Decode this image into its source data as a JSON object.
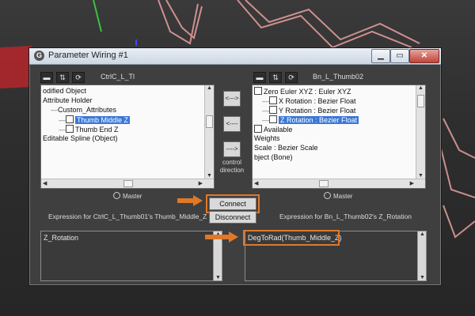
{
  "dialog": {
    "title": "Parameter Wiring #1",
    "window_buttons": {
      "minimize": "▁",
      "maximize": "▭",
      "close": "✕"
    }
  },
  "left_panel": {
    "node_name": "CtrlC_L_Tl",
    "tree_items": [
      {
        "label": "odified Object",
        "indent": 0,
        "checkbox": false,
        "selected": false
      },
      {
        "label": "Attribute Holder",
        "indent": 0,
        "checkbox": false,
        "selected": false
      },
      {
        "label": "Custom_Attributes",
        "indent": 1,
        "checkbox": false,
        "selected": false
      },
      {
        "label": "Thumb Middle Z",
        "indent": 2,
        "checkbox": true,
        "selected": true
      },
      {
        "label": "Thumb End Z",
        "indent": 2,
        "checkbox": true,
        "selected": false
      },
      {
        "label": "Editable Spline (Object)",
        "indent": 0,
        "checkbox": false,
        "selected": false
      }
    ],
    "master_label": "Master",
    "expression_label": "Expression for CtrlC_L_Thumb01's Thumb_Middle_Z",
    "expression_text": "Z_Rotation"
  },
  "right_panel": {
    "node_name": "Bn_L_Thumb02",
    "tree_items": [
      {
        "label": "Zero Euler XYZ : Euler XYZ",
        "indent": 0,
        "checkbox": true,
        "selected": false
      },
      {
        "label": "X Rotation : Bezier Float",
        "indent": 1,
        "checkbox": true,
        "selected": false
      },
      {
        "label": "Y Rotation : Bezier Float",
        "indent": 1,
        "checkbox": true,
        "selected": false
      },
      {
        "label": "Z Rotation : Bezier Float",
        "indent": 1,
        "checkbox": true,
        "selected": true
      },
      {
        "label": "Available",
        "indent": 0,
        "checkbox": true,
        "selected": false
      },
      {
        "label": "Weights",
        "indent": 0,
        "checkbox": false,
        "selected": false
      },
      {
        "label": "Scale : Bezier Scale",
        "indent": 0,
        "checkbox": false,
        "selected": false
      },
      {
        "label": "bject (Bone)",
        "indent": 0,
        "checkbox": false,
        "selected": false
      }
    ],
    "master_label": "Master",
    "expression_label": "Expression for Bn_L_Thumb02's Z_Rotation",
    "expression_text": "DegToRad(Thumb_Middle_Z)"
  },
  "direction_buttons": {
    "right": "<--->",
    "left": "<----",
    "both": "---->",
    "label_line1": "control",
    "label_line2": "direction"
  },
  "actions": {
    "connect": "Connect",
    "disconnect": "Disconnect"
  },
  "colors": {
    "selection": "#3a78d6",
    "highlight": "#e0782a",
    "dialog_bg": "#3f3f3f"
  }
}
